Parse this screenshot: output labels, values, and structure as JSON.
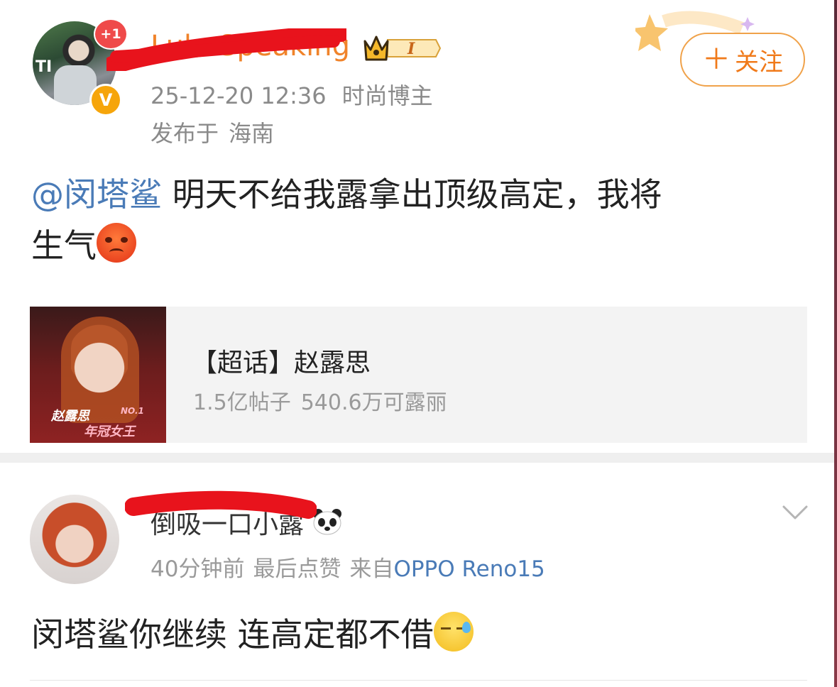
{
  "post": {
    "follow_badge": "+1",
    "username": "Lulu Speaking",
    "verified_mark": "V",
    "vip_level": "I",
    "date": "25-12-20 12:36",
    "role": "时尚博主",
    "published_prefix": "发布于",
    "location": "海南",
    "follow_button": {
      "icon": "＋",
      "label": "关注"
    },
    "mention": "@闵塔鲨",
    "text_part1": " 明天不给我露拿出顶级高定，我将",
    "text_part2": "生气",
    "emoji": "angry-face-icon"
  },
  "topic_card": {
    "title": "【超话】赵露思",
    "posts": "1.5亿帖子",
    "fans": "540.6万可露丽",
    "image_text": [
      "赵露思",
      "年冠女王",
      "NO.1"
    ]
  },
  "comment": {
    "username": "倒吸一口小露",
    "time": "40分钟前",
    "last_like": "最后点赞",
    "from": "来自",
    "device": "OPPO Reno15",
    "text": "闵塔鲨你继续 连高定都不借",
    "emoji": "sweat-face-icon"
  },
  "colors": {
    "accent_orange": "#f07a1a",
    "link_blue": "#4a7bb7",
    "redaction_red": "#e8131c",
    "meta_gray": "#8a8a8a"
  }
}
